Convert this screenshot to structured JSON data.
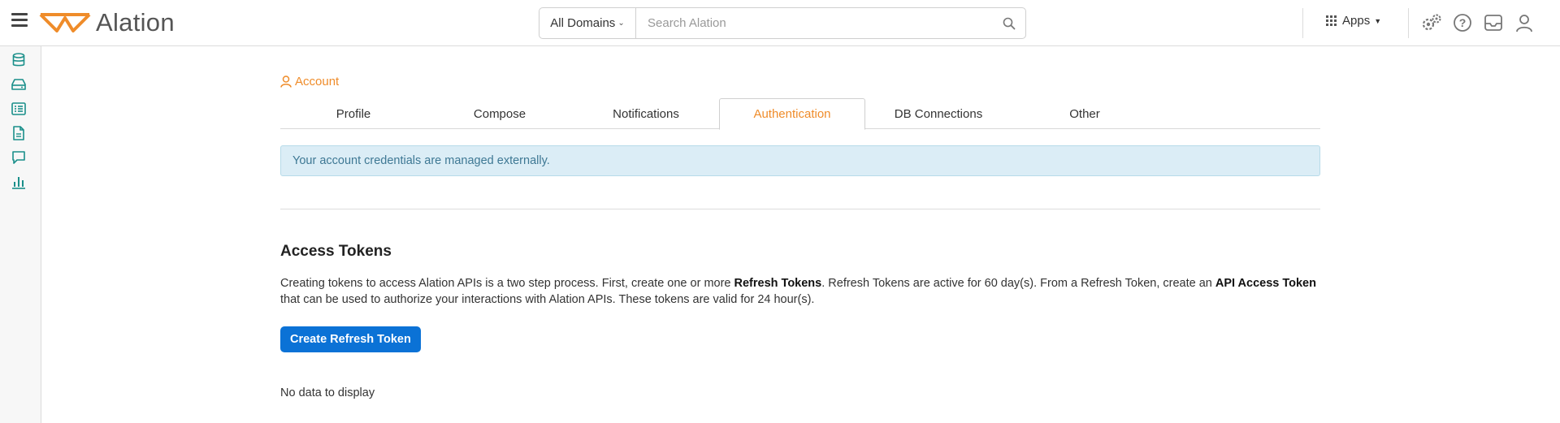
{
  "brand": {
    "name": "Alation",
    "color": "#ef8c2a"
  },
  "header": {
    "domain_select": "All Domains",
    "search_placeholder": "Search Alation",
    "apps_label": "Apps",
    "icons": [
      "menu-icon",
      "search-icon",
      "apps-grid-icon",
      "settings-icon",
      "help-icon",
      "inbox-icon",
      "user-icon"
    ]
  },
  "leftrail": {
    "icons": [
      "database-icon",
      "drive-icon",
      "catalog-list-icon",
      "document-icon",
      "conversation-icon",
      "chart-icon"
    ]
  },
  "main": {
    "breadcrumb": "Account",
    "tabs": [
      {
        "label": "Profile",
        "active": false
      },
      {
        "label": "Compose",
        "active": false
      },
      {
        "label": "Notifications",
        "active": false
      },
      {
        "label": "Authentication",
        "active": true
      },
      {
        "label": "DB Connections",
        "active": false
      },
      {
        "label": "Other",
        "active": false
      }
    ],
    "alert": "Your account credentials are managed externally.",
    "section_title": "Access Tokens",
    "description": {
      "part1": "Creating tokens to access Alation APIs is a two step process. First, create one or more ",
      "bold1": "Refresh Tokens",
      "part2": ". Refresh Tokens are active for 60 day(s). From a Refresh Token, create an ",
      "bold2": "API Access Token",
      "part3": " that can be used to authorize your interactions with Alation APIs. These tokens are valid for 24 hour(s)."
    },
    "create_button": "Create Refresh Token",
    "empty_state": "No data to display"
  },
  "colors": {
    "accent": "#ef8c2a",
    "primary_button": "#0b72d6",
    "alert_bg": "#dbedf6",
    "alert_text": "#3e7894",
    "rail_icon": "#1a8f8a"
  }
}
